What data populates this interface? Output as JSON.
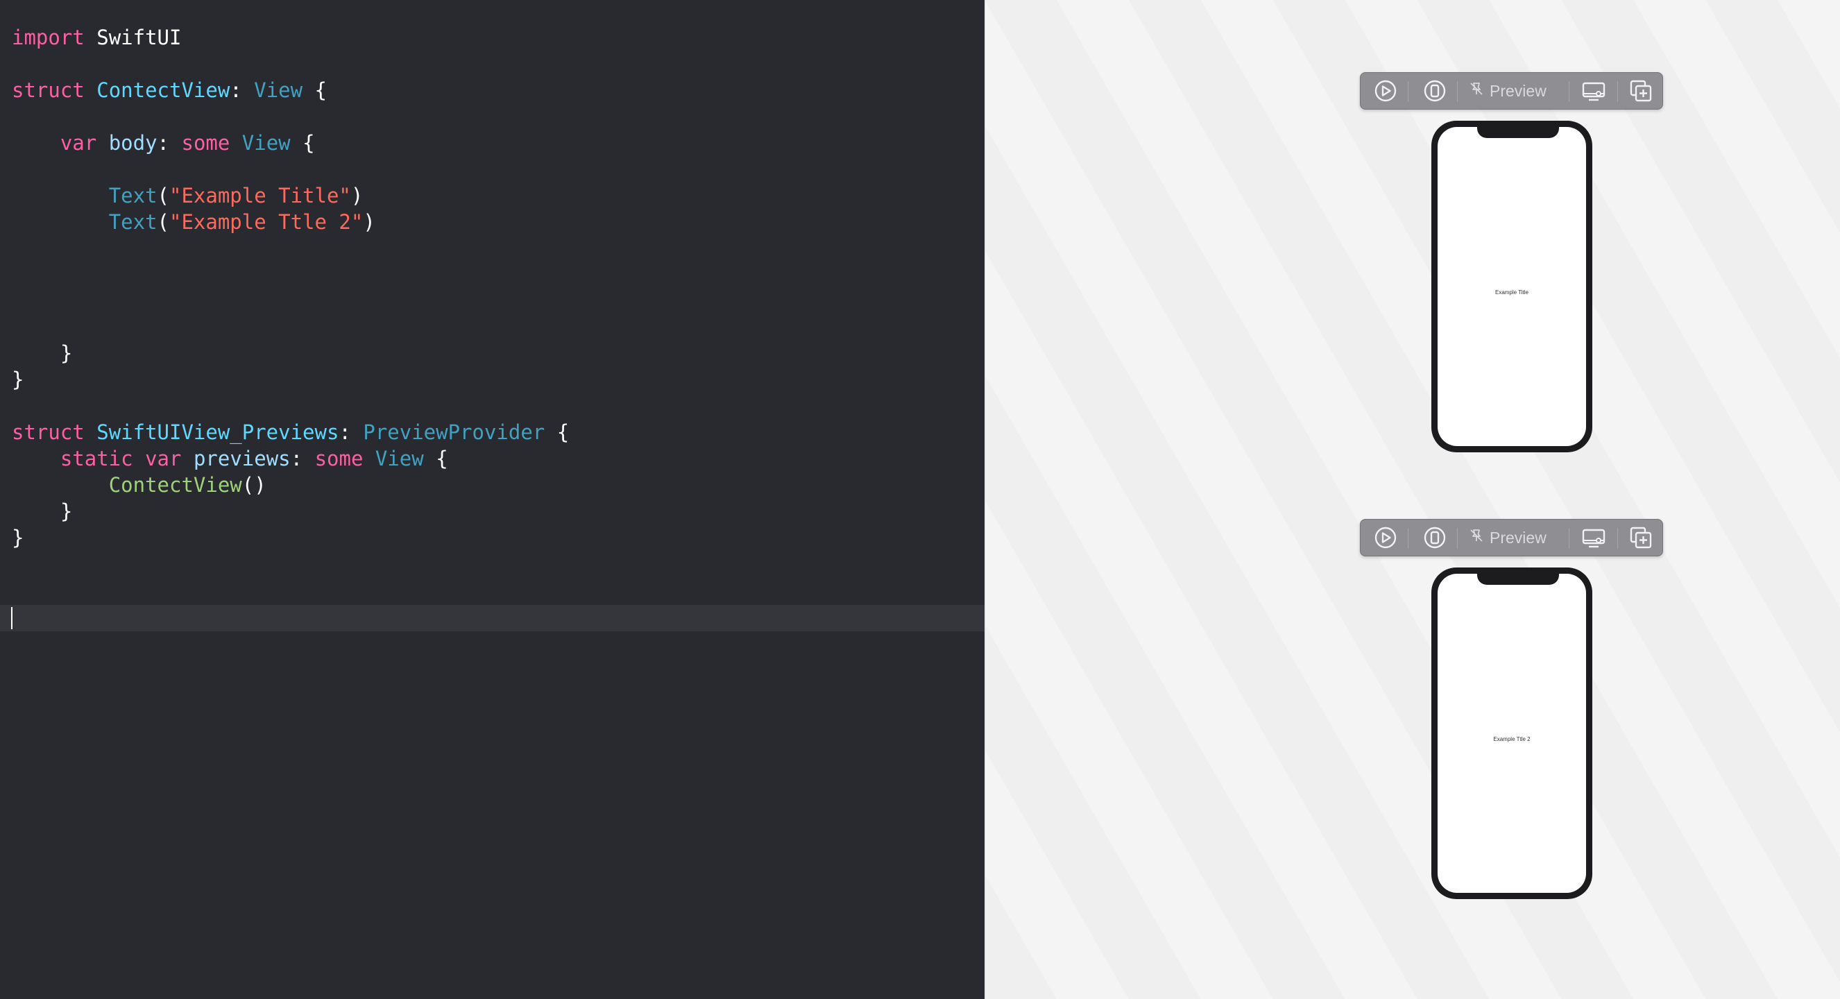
{
  "editor": {
    "tokens": {
      "import_kw": "import",
      "module": "SwiftUI",
      "struct_kw": "struct",
      "view_name": "ContectView",
      "view_colon": ":",
      "view_type": "View",
      "open_brace": "{",
      "close_brace": "}",
      "var_kw": "var",
      "body_name": "body",
      "some_kw": "some",
      "text_fn": "Text",
      "paren_open": "(",
      "paren_close": ")",
      "string_1": "\"Example Title\"",
      "string_2": "\"Example Ttle 2\"",
      "previews_struct": "SwiftUIView_Previews",
      "provider_type": "PreviewProvider",
      "static_kw": "static",
      "previews_name": "previews",
      "contect_call": "ContectView",
      "call_parens": "()"
    }
  },
  "preview_canvas": {
    "toolbar_label": "Preview",
    "icons": [
      "play-icon",
      "device-icon",
      "preview-pin-icon",
      "device-settings-icon",
      "duplicate-preview-icon"
    ],
    "previews": [
      {
        "screen_text": "Example Title"
      },
      {
        "screen_text": "Example Ttle 2"
      }
    ]
  },
  "colors": {
    "editor_background": "#292a30",
    "keyword": "#fc5fa3",
    "type_declaration": "#5dd8ff",
    "other_type": "#41a1c0",
    "string": "#fc6a5d",
    "function_call": "#9ed27a"
  }
}
